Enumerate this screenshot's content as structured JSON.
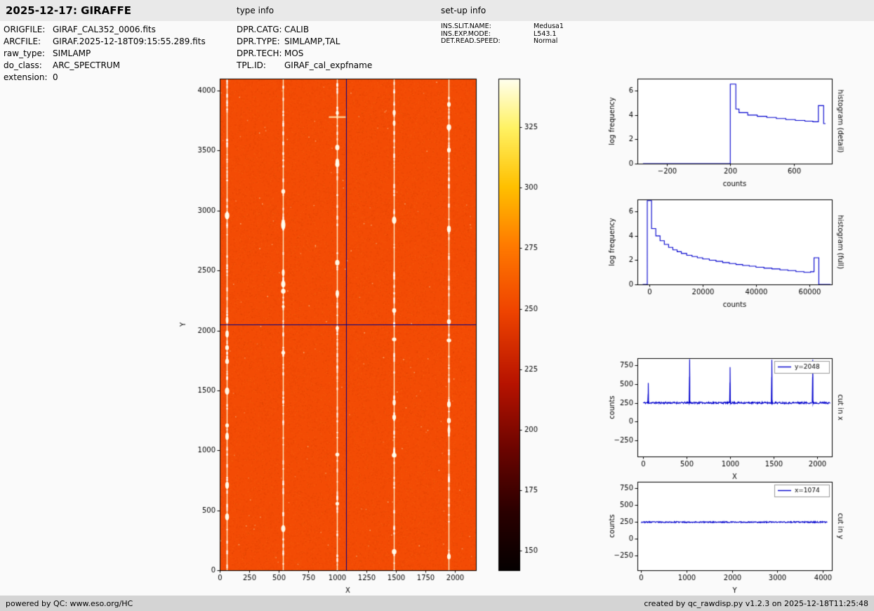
{
  "header": {
    "title": "2025-12-17: GIRAFFE",
    "type_info_label": "type info",
    "setup_info_label": "set-up info"
  },
  "file_info": {
    "rows": [
      {
        "label": "ORIGFILE:",
        "value": "GIRAF_CAL352_0006.fits"
      },
      {
        "label": "ARCFILE:",
        "value": "GIRAF.2025-12-18T09:15:55.289.fits"
      },
      {
        "label": "raw_type:",
        "value": "SIMLAMP"
      },
      {
        "label": "do_class:",
        "value": "ARC_SPECTRUM"
      },
      {
        "label": "extension:",
        "value": "0"
      }
    ]
  },
  "type_info": {
    "rows": [
      {
        "label": "DPR.CATG:",
        "value": "CALIB"
      },
      {
        "label": "DPR.TYPE:",
        "value": "SIMLAMP,TAL"
      },
      {
        "label": "DPR.TECH:",
        "value": "MOS"
      },
      {
        "label": "TPL.ID:",
        "value": "GIRAF_cal_expfname"
      }
    ]
  },
  "setup_info": {
    "rows": [
      {
        "label": "INS.SLIT.NAME:",
        "value": "Medusa1"
      },
      {
        "label": "INS.EXP.MODE:",
        "value": "L543.1"
      },
      {
        "label": "DET.READ.SPEED:",
        "value": "Normal"
      }
    ]
  },
  "footer": {
    "left": "powered by QC: www.eso.org/HC",
    "right": "created by qc_rawdisp.py v1.2.3 on 2025-12-18T11:25:48"
  },
  "chart_data": [
    {
      "id": "detector",
      "type": "heatmap",
      "xlabel": "X",
      "ylabel": "Y",
      "xlim": [
        0,
        2180
      ],
      "ylim": [
        0,
        4100
      ],
      "xticks": [
        0,
        250,
        500,
        750,
        1000,
        1250,
        1500,
        1750,
        2000
      ],
      "yticks": [
        0,
        500,
        1000,
        1500,
        2000,
        2500,
        3000,
        3500,
        4000
      ],
      "background_level": 250,
      "base_color": "#f34b04",
      "fiber_lines_x": [
        60,
        535,
        1000,
        1480,
        1950
      ],
      "crosshair": {
        "x": 1074,
        "y": 2048,
        "color": "#00008b"
      }
    },
    {
      "id": "colorbar",
      "type": "colorbar",
      "vmin": 142,
      "vmax": 345,
      "ticks": [
        150,
        175,
        200,
        225,
        250,
        275,
        300,
        325
      ],
      "stops": [
        {
          "pos": 0.0,
          "color": "#050000"
        },
        {
          "pos": 0.12,
          "color": "#2b0000"
        },
        {
          "pos": 0.25,
          "color": "#6e0500"
        },
        {
          "pos": 0.38,
          "color": "#b71300"
        },
        {
          "pos": 0.53,
          "color": "#f04500"
        },
        {
          "pos": 0.66,
          "color": "#ff7a00"
        },
        {
          "pos": 0.78,
          "color": "#ffc000"
        },
        {
          "pos": 0.9,
          "color": "#fff263"
        },
        {
          "pos": 1.0,
          "color": "#fffff0"
        }
      ]
    },
    {
      "id": "hist-detail",
      "type": "line",
      "xlabel": "counts",
      "ylabel": "log frequency",
      "right_label": "histogram (detail)",
      "color": "#0000cd",
      "xlim": [
        -385,
        840
      ],
      "ylim": [
        0,
        7
      ],
      "xticks": [
        -200,
        200,
        600
      ],
      "yticks": [
        0,
        2,
        4,
        6
      ],
      "x": [
        -350,
        200,
        200,
        235,
        235,
        255,
        255,
        310,
        310,
        370,
        370,
        430,
        430,
        490,
        490,
        550,
        550,
        610,
        610,
        670,
        670,
        720,
        720,
        755,
        755,
        788,
        788,
        800
      ],
      "y": [
        0,
        0,
        6.55,
        6.55,
        4.5,
        4.5,
        4.2,
        4.2,
        4.0,
        4.0,
        3.9,
        3.9,
        3.8,
        3.8,
        3.72,
        3.72,
        3.63,
        3.63,
        3.56,
        3.56,
        3.5,
        3.5,
        3.45,
        3.45,
        4.78,
        4.78,
        3.3,
        3.3
      ]
    },
    {
      "id": "hist-full",
      "type": "line",
      "xlabel": "counts",
      "ylabel": "log frequency",
      "right_label": "histogram (full)",
      "color": "#0000cd",
      "xlim": [
        -4500,
        68500
      ],
      "ylim": [
        0,
        7
      ],
      "xticks": [
        0,
        20000,
        40000,
        60000
      ],
      "yticks": [
        0,
        2,
        4,
        6
      ],
      "x": [
        -2500,
        -800,
        -800,
        800,
        800,
        2400,
        2400,
        4000,
        4000,
        5600,
        5600,
        7200,
        7200,
        8800,
        8800,
        10400,
        10400,
        12000,
        12000,
        14000,
        14000,
        16000,
        16000,
        18000,
        18000,
        20000,
        20000,
        22500,
        22500,
        25000,
        25000,
        27500,
        27500,
        30000,
        30000,
        32500,
        32500,
        35000,
        35000,
        37500,
        37500,
        40000,
        40000,
        43000,
        43000,
        46000,
        46000,
        49000,
        49000,
        52000,
        52000,
        55000,
        55000,
        58000,
        58000,
        60500,
        60500,
        61800,
        61800,
        63600,
        63600,
        68000
      ],
      "y": [
        0,
        0,
        6.9,
        6.9,
        4.6,
        4.6,
        4.0,
        4.0,
        3.6,
        3.6,
        3.3,
        3.3,
        3.05,
        3.05,
        2.85,
        2.85,
        2.7,
        2.7,
        2.55,
        2.55,
        2.4,
        2.4,
        2.3,
        2.3,
        2.2,
        2.2,
        2.1,
        2.1,
        2.0,
        2.0,
        1.9,
        1.9,
        1.8,
        1.8,
        1.72,
        1.72,
        1.64,
        1.64,
        1.56,
        1.56,
        1.5,
        1.5,
        1.42,
        1.42,
        1.34,
        1.34,
        1.28,
        1.28,
        1.2,
        1.2,
        1.14,
        1.14,
        1.06,
        1.06,
        1.0,
        1.0,
        1.05,
        1.05,
        2.2,
        2.2,
        0,
        0
      ]
    },
    {
      "id": "cut-x",
      "type": "line",
      "xlabel": "X",
      "ylabel": "counts",
      "right_label": "cut in x",
      "legend": "y=2048",
      "color": "#0000cd",
      "xlim": [
        -65,
        2170
      ],
      "ylim": [
        -465,
        845
      ],
      "xticks": [
        0,
        500,
        1000,
        1500,
        2000
      ],
      "yticks": [
        -250,
        0,
        250,
        500,
        750
      ],
      "baseline": 250,
      "noise": 12,
      "seed": 11,
      "range": [
        0,
        2150
      ],
      "spikes": [
        {
          "x": 60,
          "peak": 515
        },
        {
          "x": 535,
          "peak": 830
        },
        {
          "x": 1000,
          "peak": 725
        },
        {
          "x": 1480,
          "peak": 825
        },
        {
          "x": 1950,
          "peak": 825
        }
      ]
    },
    {
      "id": "cut-y",
      "type": "line",
      "xlabel": "Y",
      "ylabel": "counts",
      "right_label": "cut in y",
      "legend": "x=1074",
      "color": "#0000cd",
      "xlim": [
        -80,
        4200
      ],
      "ylim": [
        -465,
        845
      ],
      "xticks": [
        0,
        1000,
        2000,
        3000,
        4000
      ],
      "yticks": [
        -250,
        0,
        250,
        500,
        750
      ],
      "baseline": 248,
      "noise": 9,
      "seed": 23,
      "range": [
        0,
        4096
      ],
      "spikes": []
    }
  ]
}
